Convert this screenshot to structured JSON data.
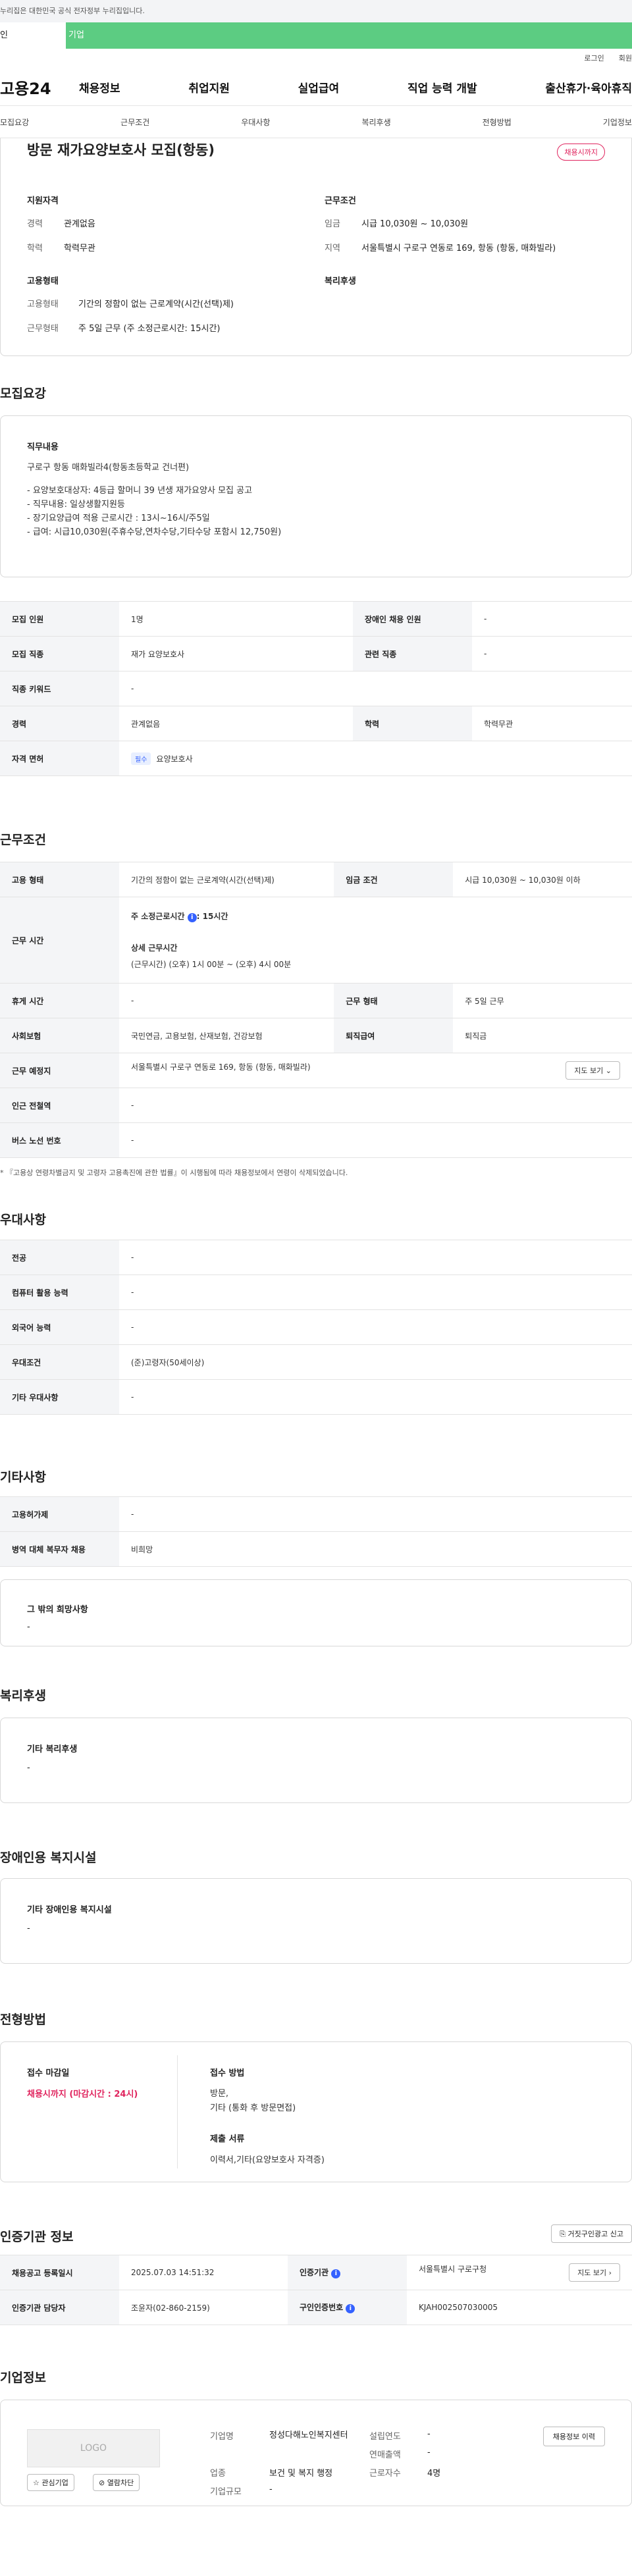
{
  "top_notice": "누리집은 대한민국 공식 전자정부 누리집입니다.",
  "tabs": {
    "left": "인",
    "right": "기업"
  },
  "util": {
    "login": "로그인",
    "join": "회원"
  },
  "gnb": {
    "logo": "고용24",
    "menu": [
      "채용정보",
      "취업지원",
      "실업급여",
      "직업 능력 개발",
      "출산휴가·육아휴직"
    ]
  },
  "subtabs": [
    "모집요강",
    "근무조건",
    "우대사항",
    "복리후생",
    "전형방법",
    "기업정보"
  ],
  "header": {
    "title": "방문 재가요양보호사 모집(항동)",
    "badge": "채용시까지",
    "qual_title": "지원자격",
    "qual": [
      {
        "k": "경력",
        "v": "관계없음"
      },
      {
        "k": "학력",
        "v": "학력무관"
      }
    ],
    "cond_title": "근무조건",
    "cond": [
      {
        "k": "임금",
        "v": "시급 10,030원 ~ 10,030원"
      },
      {
        "k": "지역",
        "v": "서울특별시 구로구 연동로 169, 항동 (항동, 매화빌라)"
      }
    ],
    "emp_title": "고용형태",
    "emp": [
      {
        "k": "고용형태",
        "v": "기간의 정함이 없는 근로계약(시간(선택)제)"
      },
      {
        "k": "근무형태",
        "v": "주 5일 근무 (주 소정근로시간: 15시간)"
      }
    ],
    "welfare_title": "복리후생"
  },
  "recruit": {
    "section_title": "모집요강",
    "duty_title": "직무내용",
    "duty_lines": [
      "구로구 항동 매화빌라4(항동초등학교 건너편)",
      "",
      "- 요양보호대상자: 4등급 할머니 39 년생 재가요양사 모집 공고",
      "- 직무내용: 일상생활지원등",
      "- 장기요양급여 적용 근로시간 : 13시~16시/주5일",
      "- 급여:  시급10,030원(주휴수당,연차수당,기타수당 포함시 12,750원)"
    ],
    "rows": [
      {
        "h1": "모집 인원",
        "v1": "1명",
        "h2": "장애인 채용 인원",
        "v2": "-"
      },
      {
        "h1": "모집 직종",
        "v1": "재가 요양보호사",
        "h2": "관련 직종",
        "v2": "-"
      },
      {
        "h1": "직종 키워드",
        "v1": "-"
      },
      {
        "h1": "경력",
        "v1": "관계없음",
        "h2": "학력",
        "v2": "학력무관"
      },
      {
        "h1": "자격 면허",
        "pill": "필수",
        "v1": "요양보호사"
      }
    ]
  },
  "work": {
    "section_title": "근무조건",
    "r1": {
      "h1": "고용 형태",
      "v1": "기간의 정함이 없는 근로계약(시간(선택)제)",
      "h2": "임금 조건",
      "v2": "시급 10,030원 ~ 10,030원 이하"
    },
    "r2": {
      "h": "근무 시간",
      "week_label": "주 소정근로시간",
      "week_val": ": 15시간",
      "detail_label": "상세 근무시간",
      "detail_val": "(근무시간) (오후) 1시 00분 ~ (오후) 4시 00분"
    },
    "r3": {
      "h1": "휴게 시간",
      "v1": "-",
      "h2": "근무 형태",
      "v2": "주 5일 근무"
    },
    "r4": {
      "h1": "사회보험",
      "v1": "국민연금, 고용보험, 산재보험, 건강보험",
      "h2": "퇴직급여",
      "v2": "퇴직금"
    },
    "r5": {
      "h": "근무 예정지",
      "v": "서울특별시 구로구 연동로 169, 항동 (항동, 매화빌라)",
      "btn": "지도 보기"
    },
    "r6": {
      "h": "인근 전철역",
      "v": "-"
    },
    "r7": {
      "h": "버스 노선 번호",
      "v": "-"
    },
    "note": "* 『고용상 연령차별금지 및 고령자 고용촉진에 관한 법률』이 시행됨에 따라 채용정보에서 연령이 삭제되었습니다."
  },
  "pref": {
    "section_title": "우대사항",
    "rows": [
      {
        "h": "전공",
        "v": "-"
      },
      {
        "h": "컴퓨터 활용 능력",
        "v": "-"
      },
      {
        "h": "외국어 능력",
        "v": "-"
      },
      {
        "h": "우대조건",
        "v": "(준)고령자(50세이상)"
      },
      {
        "h": "기타 우대사항",
        "v": "-"
      }
    ]
  },
  "etc": {
    "section_title": "기타사항",
    "rows": [
      {
        "h": "고용허가제",
        "v": "-"
      },
      {
        "h": "병역 대체 복무자 채용",
        "v": "비희망"
      }
    ],
    "box_title": "그 밖의 희망사항",
    "box_val": "-"
  },
  "welfare": {
    "section_title": "복리후생",
    "box_title": "기타 복리후생",
    "box_val": "-"
  },
  "disab": {
    "section_title": "장애인용 복지시설",
    "box_title": "기타 장애인용 복지시설",
    "box_val": "-"
  },
  "screening": {
    "section_title": "전형방법",
    "deadline_title": "접수 마감일",
    "deadline_val": "채용시까지 (마감시간 : 24시)",
    "method_title": "접수 방법",
    "method_lines": [
      "방문,",
      "기타 (통화 후 방문면접)"
    ],
    "docs_title": "제출 서류",
    "docs_val": "이력서,기타(요양보호사 자격증)"
  },
  "cert": {
    "section_title": "인증기관 정보",
    "report_btn": "거짓구인광고 신고",
    "r1": {
      "h1": "채용공고 등록일시",
      "v1": "2025.07.03 14:51:32",
      "h2": "인증기관",
      "v2": "서울특별시 구로구청",
      "btn": "지도 보기"
    },
    "r2": {
      "h1": "인증기관 담당자",
      "v1": "조윤자(02-860-2159)",
      "h2": "구인인증번호",
      "v2": "KJAH002507030005"
    }
  },
  "company": {
    "section_title": "기업정보",
    "logo": "LOGO",
    "fav_btn": "관심기업",
    "block_btn": "열람차단",
    "name_k": "기업명",
    "name_v": "정성다해노인복지센터",
    "industry_k": "업종",
    "industry_v": "보건 및 복지 행정",
    "size_k": "기업규모",
    "size_v": "-",
    "year_k": "설립연도",
    "year_v": "-",
    "sales_k": "연매출액",
    "sales_v": "-",
    "emp_k": "근로자수",
    "emp_v": "4명",
    "history_btn": "채용정보 이력"
  },
  "colors": {
    "green": "#5ccc82",
    "red": "#e0245e",
    "blue": "#3461ff"
  }
}
